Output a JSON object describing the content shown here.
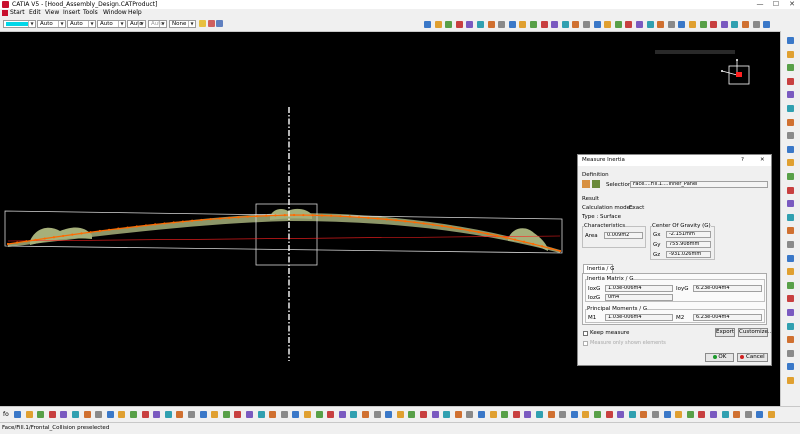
{
  "window": {
    "title": "CATIA V5 - [Hood_Assembly_Design.CATProduct]",
    "minimize": "—",
    "maximize": "☐",
    "close": "✕"
  },
  "menu": [
    {
      "id": "start",
      "label": "Start"
    },
    {
      "id": "edit",
      "label": "Edit"
    },
    {
      "id": "view",
      "label": "View"
    },
    {
      "id": "insert",
      "label": "Insert"
    },
    {
      "id": "tools",
      "label": "Tools"
    },
    {
      "id": "window",
      "label": "Window"
    },
    {
      "id": "help",
      "label": "Help"
    }
  ],
  "graphic_properties": {
    "color_swatch": "#00d7e8",
    "combos": [
      "Auto",
      "Auto",
      "Auto",
      "Auto",
      "Auto"
    ],
    "layer": "None"
  },
  "dialog": {
    "title": "Measure Inertia",
    "help": "?",
    "close": "✕",
    "definition_label": "Definition",
    "selection_label": "Selection :",
    "selection_value": "Face....Fill.1....Inner_Panel",
    "result_label": "Result",
    "calc_mode_label": "Calculation mode :",
    "calc_mode_value": "Exact",
    "type_label": "Type :",
    "type_value": "Surface",
    "characteristics_label": "Characteristics",
    "area_label": "Area",
    "area_value": "0.009m2",
    "cog_label": "Center Of Gravity (G)",
    "gx_label": "Gx",
    "gx_value": "-2.151mm",
    "gy_label": "Gy",
    "gy_value": "755.908mm",
    "gz_label": "Gz",
    "gz_value": "-931.026mm",
    "tab_label": "Inertia / G",
    "inertia_matrix_label": "Inertia Matrix / G",
    "ioxg_label": "IoxG",
    "ioxg_value": "1.03e-006m4",
    "ioyg_label": "IoyG",
    "ioyg_value": "6.23e-004m4",
    "iozg_label": "IozG",
    "iozg_value": "0m4",
    "principal_label": "Principal Moments / G",
    "m1_label": "M1",
    "m1_value": "1.03e-006m4",
    "m2_label": "M2",
    "m2_value": "6.23e-004m4",
    "keep_measure_label": "Keep measure",
    "only_shown_label": "Measure only shown elements",
    "export_label": "Export",
    "customize_label": "Customize...",
    "ok_label": "OK",
    "cancel_label": "Cancel"
  },
  "status": {
    "text": "Face/Fill.1/Frontal_Collision preselected"
  },
  "command_input": {
    "prompt": "fᴏ"
  },
  "colors": {
    "curve": "#ff6a00",
    "fill": "#a6b07a",
    "axis": "#ffffff",
    "red_line": "#ff2020"
  }
}
